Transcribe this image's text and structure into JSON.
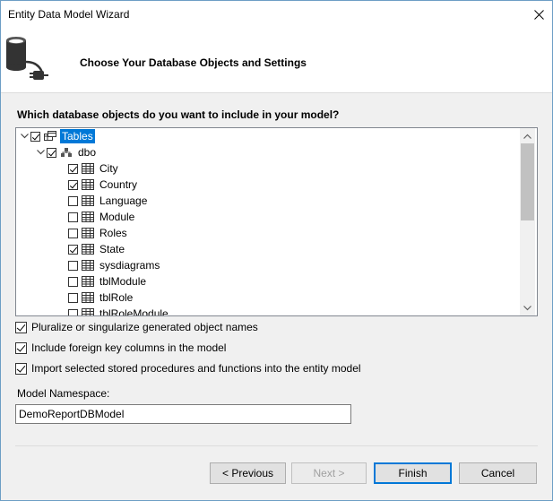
{
  "window": {
    "title": "Entity Data Model Wizard"
  },
  "header": {
    "title": "Choose Your Database Objects and Settings",
    "icon": "database-plug-icon"
  },
  "question": "Which database objects do you want to include in your model?",
  "tree": {
    "root": {
      "label": "Tables",
      "checked": true,
      "expanded": true,
      "selected": true
    },
    "schema": {
      "label": "dbo",
      "checked": true,
      "expanded": true
    },
    "tables": [
      {
        "label": "City",
        "checked": true
      },
      {
        "label": "Country",
        "checked": true
      },
      {
        "label": "Language",
        "checked": false
      },
      {
        "label": "Module",
        "checked": false
      },
      {
        "label": "Roles",
        "checked": false
      },
      {
        "label": "State",
        "checked": true
      },
      {
        "label": "sysdiagrams",
        "checked": false
      },
      {
        "label": "tblModule",
        "checked": false
      },
      {
        "label": "tblRole",
        "checked": false
      },
      {
        "label": "tblRoleModule",
        "checked": false
      }
    ]
  },
  "options": [
    {
      "label": "Pluralize or singularize generated object names",
      "checked": true
    },
    {
      "label": "Include foreign key columns in the model",
      "checked": true
    },
    {
      "label": "Import selected stored procedures and functions into the entity model",
      "checked": true
    }
  ],
  "namespace": {
    "label": "Model Namespace:",
    "value": "DemoReportDBModel"
  },
  "buttons": {
    "previous": "< Previous",
    "next": "Next >",
    "finish": "Finish",
    "cancel": "Cancel"
  }
}
